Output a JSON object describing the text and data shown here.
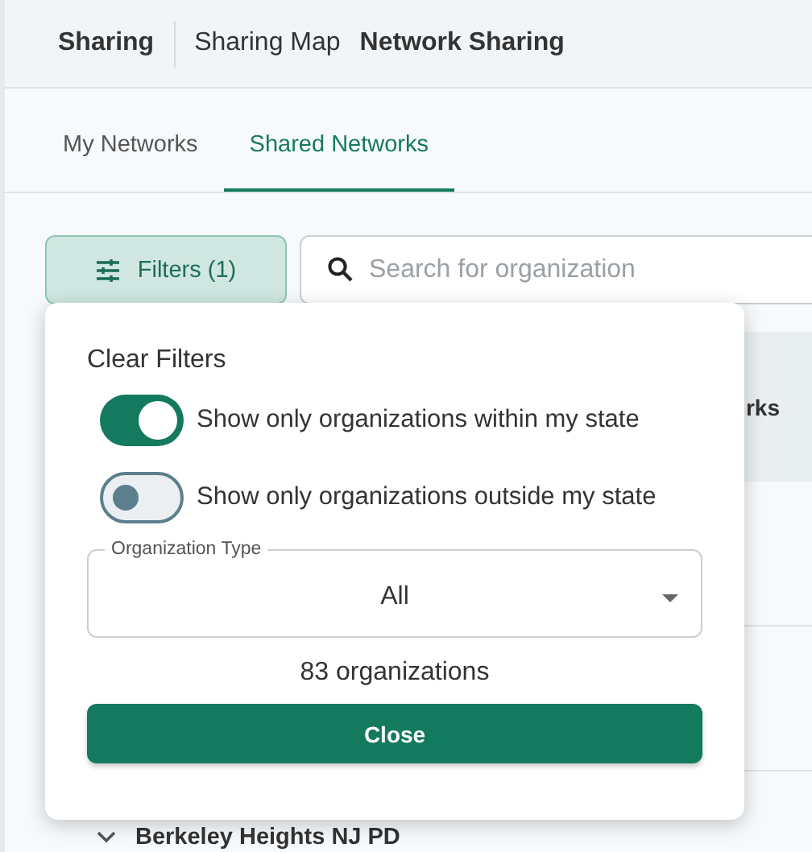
{
  "breadcrumb": [
    {
      "label": "Sharing",
      "kind": "root"
    },
    {
      "label": "Sharing Map",
      "kind": "link"
    },
    {
      "label": "Network Sharing",
      "kind": "current"
    }
  ],
  "tabs": [
    {
      "label": "My Networks",
      "selected": false
    },
    {
      "label": "Shared Networks",
      "selected": true
    }
  ],
  "filters_button": {
    "label": "Filters (1)"
  },
  "search": {
    "placeholder": "Search for organization"
  },
  "table": {
    "column_header": "rks",
    "rows": [
      {
        "name": "Berkeley Heights NJ PD",
        "expanded": false
      }
    ]
  },
  "filter_popup": {
    "clear_label": "Clear Filters",
    "toggles": [
      {
        "label": "Show only organizations within my state",
        "on": true
      },
      {
        "label": "Show only organizations outside my state",
        "on": false
      }
    ],
    "organization_type": {
      "label": "Organization Type",
      "value": "All"
    },
    "count": "83 organizations",
    "close_label": "Close"
  }
}
